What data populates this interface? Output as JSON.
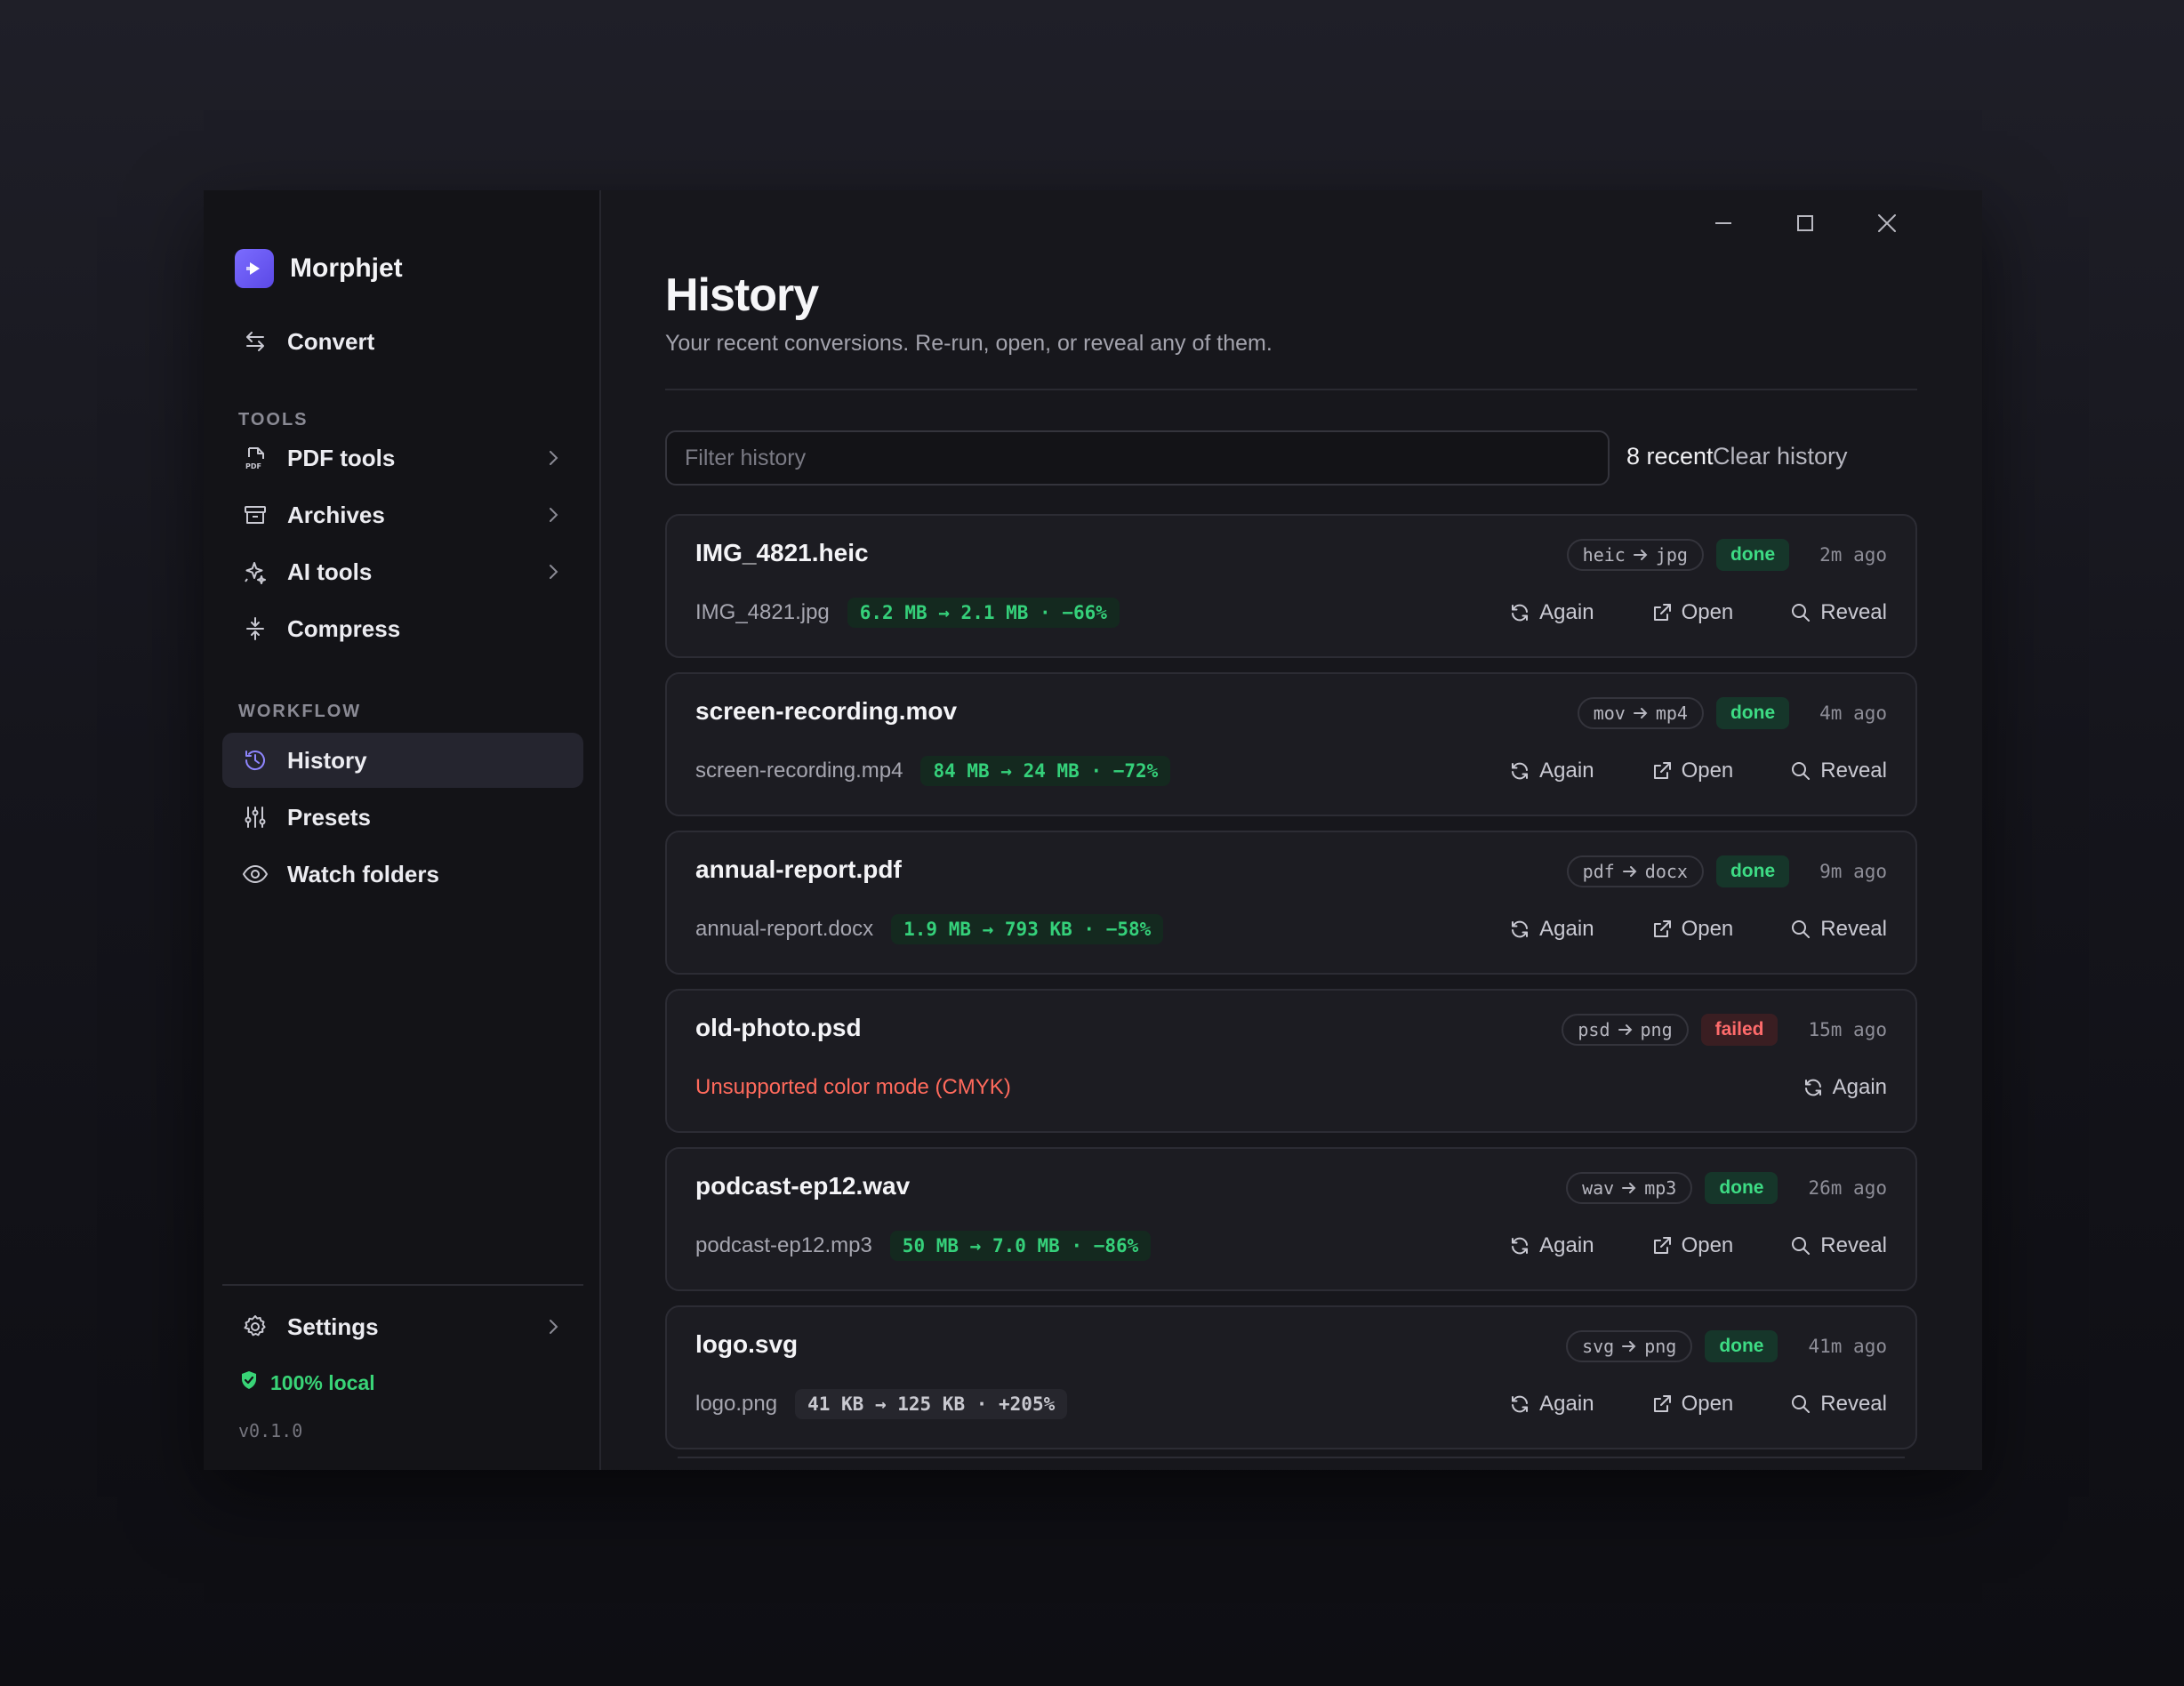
{
  "app": {
    "name": "Morphjet",
    "accent": "#6b5cf0"
  },
  "sidebar": {
    "convert": {
      "label": "Convert",
      "icon": "arrows-swap-icon"
    },
    "tools_label": "TOOLS",
    "tools": [
      {
        "label": "PDF tools",
        "icon": "pdf-file-icon",
        "submenu": true
      },
      {
        "label": "Archives",
        "icon": "archive-box-icon",
        "submenu": true
      },
      {
        "label": "AI tools",
        "icon": "sparkle-icon",
        "submenu": true
      },
      {
        "label": "Compress",
        "icon": "compress-icon",
        "submenu": false
      }
    ],
    "workflow_label": "WORKFLOW",
    "workflow": [
      {
        "label": "History",
        "icon": "history-clock-icon",
        "active": true
      },
      {
        "label": "Presets",
        "icon": "sliders-icon",
        "active": false
      },
      {
        "label": "Watch folders",
        "icon": "eye-icon",
        "active": false
      }
    ],
    "settings": {
      "label": "Settings",
      "icon": "gear-icon"
    },
    "local_badge": "100% local",
    "version": "v0.1.0"
  },
  "page": {
    "title": "History",
    "subtitle": "Your recent conversions. Re-run, open, or reveal any of them."
  },
  "toolbar": {
    "filter_placeholder": "Filter history",
    "filter_value": "",
    "recent_count": "8 recent",
    "clear_label": "Clear history"
  },
  "actions": {
    "again": "Again",
    "open": "Open",
    "reveal": "Reveal"
  },
  "history": [
    {
      "name": "IMG_4821.heic",
      "from": "heic",
      "to": "jpg",
      "status": "done",
      "time": "2m ago",
      "output": "IMG_4821.jpg",
      "delta": "6.2 MB → 2.1 MB · −66%",
      "delta_kind": "good",
      "error": ""
    },
    {
      "name": "screen-recording.mov",
      "from": "mov",
      "to": "mp4",
      "status": "done",
      "time": "4m ago",
      "output": "screen-recording.mp4",
      "delta": "84 MB → 24 MB · −72%",
      "delta_kind": "good",
      "error": ""
    },
    {
      "name": "annual-report.pdf",
      "from": "pdf",
      "to": "docx",
      "status": "done",
      "time": "9m ago",
      "output": "annual-report.docx",
      "delta": "1.9 MB → 793 KB · −58%",
      "delta_kind": "good",
      "error": ""
    },
    {
      "name": "old-photo.psd",
      "from": "psd",
      "to": "png",
      "status": "failed",
      "time": "15m ago",
      "output": "",
      "delta": "",
      "delta_kind": "",
      "error": "Unsupported color mode (CMYK)"
    },
    {
      "name": "podcast-ep12.wav",
      "from": "wav",
      "to": "mp3",
      "status": "done",
      "time": "26m ago",
      "output": "podcast-ep12.mp3",
      "delta": "50 MB → 7.0 MB · −86%",
      "delta_kind": "good",
      "error": ""
    },
    {
      "name": "logo.svg",
      "from": "svg",
      "to": "png",
      "status": "done",
      "time": "41m ago",
      "output": "logo.png",
      "delta": "41 KB → 125 KB · +205%",
      "delta_kind": "bad",
      "error": ""
    }
  ]
}
